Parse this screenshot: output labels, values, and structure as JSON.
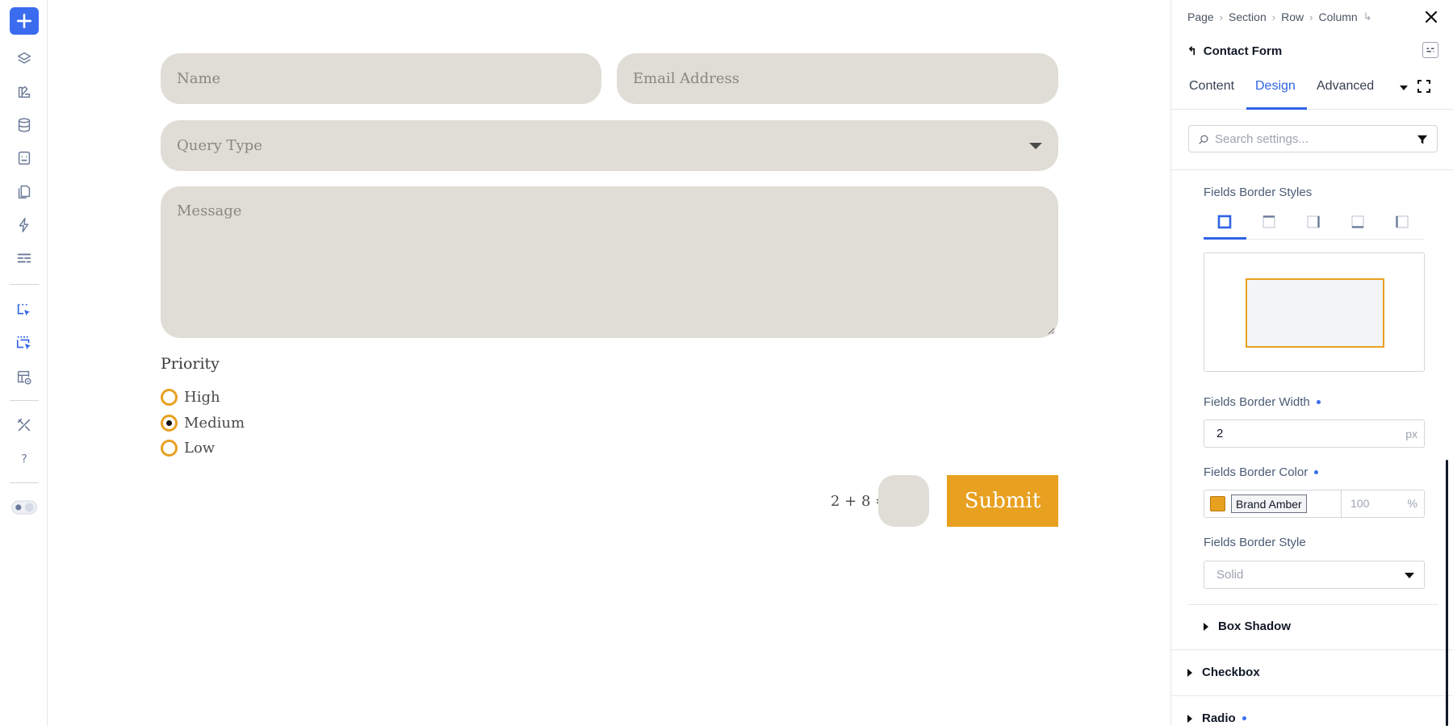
{
  "rail": {
    "icons": [
      "plus-icon",
      "layers-icon",
      "palette-icon",
      "database-icon",
      "form-icon",
      "pages-icon",
      "lightning-icon",
      "layout-icon",
      "select-element-icon",
      "multi-select-icon",
      "preview-layout-icon",
      "tools-icon",
      "help-icon",
      "theme-toggle-icon"
    ]
  },
  "form": {
    "name_placeholder": "Name",
    "email_placeholder": "Email Address",
    "query_placeholder": "Query Type",
    "message_placeholder": "Message",
    "priority_label": "Priority",
    "priority_options": [
      {
        "label": "High",
        "selected": false
      },
      {
        "label": "Medium",
        "selected": true
      },
      {
        "label": "Low",
        "selected": false
      }
    ],
    "captcha_question": "2 + 8 =",
    "submit_label": "Submit"
  },
  "panel": {
    "breadcrumbs": [
      "Page",
      "Section",
      "Row",
      "Column"
    ],
    "element_title": "Contact Form",
    "tabs": [
      "Content",
      "Design",
      "Advanced"
    ],
    "active_tab": "Design",
    "search_placeholder": "Search settings...",
    "border_styles_label": "Fields Border Styles",
    "border_width_label": "Fields Border Width",
    "border_width_value": "2",
    "border_width_unit": "px",
    "border_color_label": "Fields Border Color",
    "border_color_name": "Brand Amber",
    "border_color_hex": "#e8a020",
    "border_color_opacity": "100",
    "border_color_opacity_unit": "%",
    "border_style_label": "Fields Border Style",
    "border_style_value": "Solid",
    "groups": {
      "box_shadow": "Box Shadow",
      "checkbox": "Checkbox",
      "radio": "Radio"
    }
  },
  "colors": {
    "accent": "#2f63e6",
    "brand_amber": "#e8a020",
    "field_bg": "#e0ddd6"
  }
}
